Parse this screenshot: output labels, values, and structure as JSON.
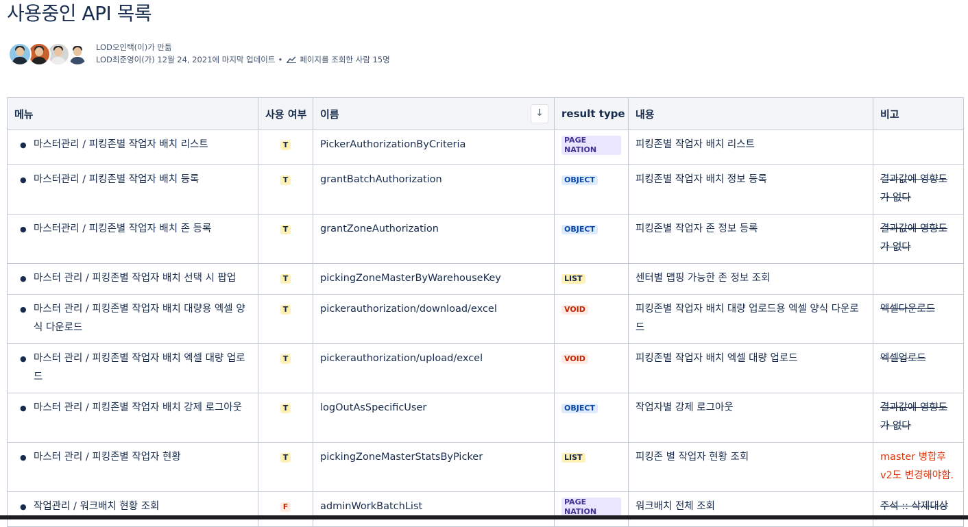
{
  "page": {
    "title": "사용중인 API 목록"
  },
  "byline": {
    "created": "LOD오인택(이)가 만듦",
    "updated": "LOD최준영이(가) 12월 24, 2021에 마지막 업데이트",
    "separator": "•",
    "views": "페이지를 조회한 사람 15명"
  },
  "table": {
    "headers": [
      "메뉴",
      "사용 여부",
      "이름",
      "result type",
      "내용",
      "비고"
    ],
    "sort_icon": "↓",
    "rows": [
      {
        "menu": "마스터관리 / 피킹존별 작업자 배치 리스트",
        "use": "T",
        "name": "PickerAuthorizationByCriteria",
        "type": "PAGE NATION",
        "content": "피킹존별 작업자 배치 리스트",
        "note": "",
        "note_style": ""
      },
      {
        "menu": "마스터관리 / 피킹존별 작업자 배치 등록",
        "use": "T",
        "name": "grantBatchAuthorization",
        "type": "OBJECT",
        "content": "피킹존별 작업자 배치 정보 등록",
        "note": "결과값에 영향도가 없다",
        "note_style": "strike"
      },
      {
        "menu": "마스터관리 / 피킹존별 작업자 배치 존 등록",
        "use": "T",
        "name": "grantZoneAuthorization",
        "type": "OBJECT",
        "content": "피킹존별 작업자 존 정보 등록",
        "note": "결과값에 영향도가 없다",
        "note_style": "strike"
      },
      {
        "menu": "마스터 관리 / 피킹존별 작업자 배치 선택 시 팝업",
        "use": "T",
        "name": "pickingZoneMasterByWarehouseKey",
        "type": "LIST",
        "content": "센터별 맵핑 가능한 존 정보 조회",
        "note": "",
        "note_style": ""
      },
      {
        "menu": "마스터 관리 / 피킹존별 작업자 배치 대량용 엑셀 양식 다운로드",
        "use": "T",
        "name": "pickerauthorization/download/excel",
        "type": "VOID",
        "content": "피킹존별 작업자 배치 대량 업로드용 엑셀 양식 다운로드",
        "note": "엑셀다운로드",
        "note_style": "strike"
      },
      {
        "menu": "마스터 관리 / 피킹존별 작업자 배치 엑셀 대량 업로드",
        "use": "T",
        "name": "pickerauthorization/upload/excel",
        "type": "VOID",
        "content": "피킹존별 작업자 배치 엑셀 대량 업로드",
        "note": "엑셀업로드",
        "note_style": "strike"
      },
      {
        "menu": "마스터 관리 / 피킹존별 작업자 배치 강제 로그아웃",
        "use": "T",
        "name": "logOutAsSpecificUser",
        "type": "OBJECT",
        "content": "작업자별 강제 로그아웃",
        "note": "결과값에 영향도가 없다",
        "note_style": "strike"
      },
      {
        "menu": "마스터 관리 / 피킹존별 작업자 현황",
        "use": "T",
        "name": "pickingZoneMasterStatsByPicker",
        "type": "LIST",
        "content": "피킹존 별 작업자 현황 조회",
        "note": "master 병합후 v2도 변경해야함.",
        "note_style": "red"
      },
      {
        "menu": "작업관리 / 워크배치 현황 조회",
        "use": "F",
        "name": "adminWorkBatchList",
        "type": "PAGE NATION",
        "content": "워크배치 전체 조회",
        "note": "주석 :: 삭제대상",
        "note_style": "strike"
      }
    ]
  },
  "colors": {
    "text": "#172b4d",
    "header_bg": "#f4f5f7",
    "border": "#c1c7d0",
    "red_note": "#de350b"
  }
}
